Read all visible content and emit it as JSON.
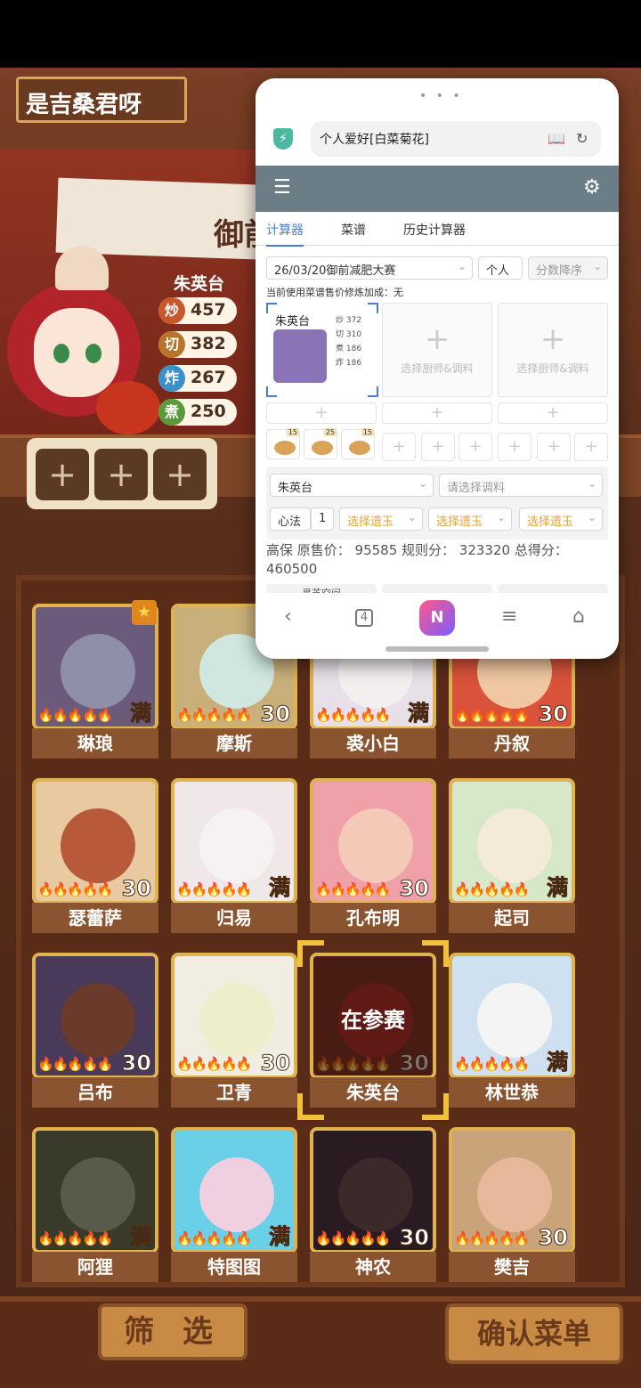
{
  "player": {
    "name": "是吉桑君呀"
  },
  "banner": {
    "text": "御前"
  },
  "featured_chef": {
    "name": "朱英台",
    "stats": [
      {
        "label": "炒",
        "value": "457",
        "color": "#c8572b"
      },
      {
        "label": "切",
        "value": "382",
        "color": "#b8742a"
      },
      {
        "label": "炸",
        "value": "267",
        "color": "#3c8fc9"
      },
      {
        "label": "煮",
        "value": "250",
        "color": "#5a9a3a"
      }
    ]
  },
  "slot_plus": "+",
  "chefs": [
    {
      "name": "琳琅",
      "level": "满",
      "bg": "#6b5a7a",
      "skin": "#8f8fa8"
    },
    {
      "name": "摩斯",
      "level": "30",
      "bg": "#c9b07a",
      "skin": "#cfe7df"
    },
    {
      "name": "裘小白",
      "level": "满",
      "bg": "#e8e0e8",
      "skin": "#f4efef"
    },
    {
      "name": "丹叙",
      "level": "30",
      "bg": "#d9533a",
      "skin": "#f0c7a0"
    },
    {
      "name": "瑟蕾萨",
      "level": "30",
      "bg": "#e8c9a0",
      "skin": "#b65a3a"
    },
    {
      "name": "归易",
      "level": "满",
      "bg": "#f0e8e8",
      "skin": "#f7f2f2"
    },
    {
      "name": "孔布明",
      "level": "30",
      "bg": "#f0a0a8",
      "skin": "#f5c9b8"
    },
    {
      "name": "起司",
      "level": "满",
      "bg": "#d7e8c8",
      "skin": "#f3ead8"
    },
    {
      "name": "吕布",
      "level": "30",
      "bg": "#4a3a5a",
      "skin": "#6a3a2a"
    },
    {
      "name": "卫青",
      "level": "30",
      "bg": "#f0eee0",
      "skin": "#eeeecc"
    },
    {
      "name": "朱英台",
      "level": "30",
      "bg": "#7a2a22",
      "skin": "#b2242a",
      "in_match": "在参赛"
    },
    {
      "name": "林世恭",
      "level": "满",
      "bg": "#cfe0f0",
      "skin": "#f4f4f4"
    },
    {
      "name": "阿狸",
      "level": "满",
      "bg": "#3a3a2a",
      "skin": "#5a5a4a"
    },
    {
      "name": "特图图",
      "level": "满",
      "bg": "#6ad0e8",
      "skin": "#f0d0e0"
    },
    {
      "name": "神农",
      "level": "30",
      "bg": "#2a1a22",
      "skin": "#3a2a2a"
    },
    {
      "name": "樊吉",
      "level": "30",
      "bg": "#c9a37a",
      "skin": "#e8b89a"
    }
  ],
  "buttons": {
    "filter": "筛 选",
    "confirm": "确认菜单"
  },
  "browser": {
    "dots": "• • •",
    "url": "个人爱好[白菜菊花]",
    "tabs": [
      "计算器",
      "菜谱",
      "历史计算器"
    ],
    "contest": "26/03/20御前减肥大赛",
    "scope": "个人",
    "sort_placeholder": "分数降序",
    "note": "当前使用菜谱售价修炼加成：无",
    "chef_slot": {
      "name": "朱英台",
      "stats": [
        "炒 372",
        "切 310",
        "煮 186",
        "炸 186"
      ]
    },
    "empty_slot_label": "选择厨师&调料",
    "dish_counts": [
      "15",
      "25",
      "15"
    ],
    "chef_select": "朱英台",
    "seasoning_placeholder": "请选择调料",
    "heart_label": "心法",
    "heart_value": "1",
    "relic_placeholder": "选择遗玉",
    "summary": "高保 原售价： 95585 规则分： 323320 总得分： 460500",
    "cut_label": "灵芝空间",
    "tab_count": "4",
    "app_icon": "N"
  }
}
